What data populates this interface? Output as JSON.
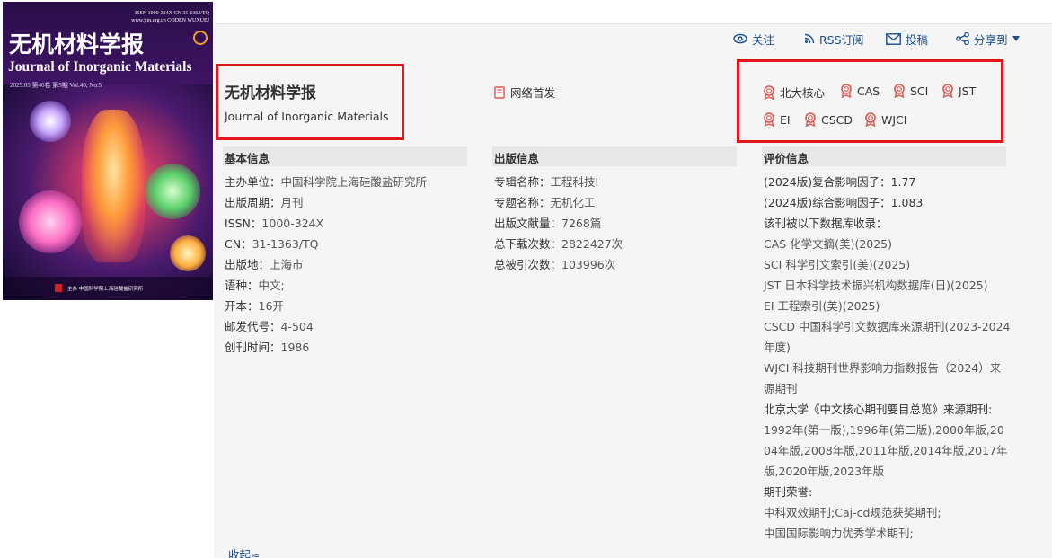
{
  "cover": {
    "issn_line": "ISSN 1000-324X   CN 31-1363/TQ",
    "web_line": "www.jim.org.cn   CODEN WUXUEJ",
    "title_cn": "无机材料学报",
    "title_en": "Journal of Inorganic Materials",
    "issue_line": "2025.05  第40卷  第5期  Vol.40, No.5",
    "footer_line": "主办    中国科学院上海硅酸盐研究所"
  },
  "toolbar": {
    "follow": "关注",
    "rss": "RSS订阅",
    "submit": "投稿",
    "share": "分享到"
  },
  "journal": {
    "title_cn": "无机材料学报",
    "title_en": "Journal of Inorganic Materials",
    "net_first": "网络首发"
  },
  "badges": [
    "北大核心",
    "CAS",
    "SCI",
    "JST",
    "EI",
    "CSCD",
    "WJCI"
  ],
  "basic": {
    "header": "基本信息",
    "rows": [
      {
        "k": "主办单位：",
        "v": "中国科学院上海硅酸盐研究所"
      },
      {
        "k": "出版周期：",
        "v": "月刊"
      },
      {
        "k": "ISSN：",
        "v": "1000-324X"
      },
      {
        "k": "CN：",
        "v": "31-1363/TQ"
      },
      {
        "k": "出版地：",
        "v": "上海市"
      },
      {
        "k": "语种：",
        "v": "中文;"
      },
      {
        "k": "开本：",
        "v": "16开"
      },
      {
        "k": "邮发代号：",
        "v": "4-504"
      },
      {
        "k": "创刊时间：",
        "v": "1986"
      }
    ]
  },
  "publish": {
    "header": "出版信息",
    "rows": [
      {
        "k": "专辑名称：",
        "v": "工程科技I"
      },
      {
        "k": "专题名称：",
        "v": "无机化工"
      },
      {
        "k": "出版文献量：",
        "v": "7268篇"
      },
      {
        "k": "总下载次数：",
        "v": "2822427次"
      },
      {
        "k": "总被引次数：",
        "v": "103996次"
      }
    ]
  },
  "evaluation": {
    "header": "评价信息",
    "composite_if": "(2024版)复合影响因子：1.77",
    "overall_if": "(2024版)综合影响因子：1.083",
    "db_intro": "该刊被以下数据库收录：",
    "databases": [
      "CAS 化学文摘(美)(2025)",
      "SCI 科学引文索引(美)(2025)",
      "JST 日本科学技术振兴机构数据库(日)(2025)",
      "EI 工程索引(美)(2025)",
      "CSCD 中国科学引文数据库来源期刊(2023-2024年度)",
      "WJCI 科技期刊世界影响力指数报告（2024）来源期刊"
    ],
    "pku_intro": "北京大学《中文核心期刊要目总览》来源期刊:",
    "pku_years": "1992年(第一版),1996年(第二版),2000年版,2004年版,2008年版,2011年版,2014年版,2017年版,2020年版,2023年版",
    "honors_label": "期刊荣誉:",
    "honors": [
      "中科双效期刊;Caj-cd规范获奖期刊;",
      "中国国际影响力优秀学术期刊;"
    ]
  },
  "collapse": "收起≈",
  "colors": {
    "link": "#1a4e8f",
    "badge": "#e0574f",
    "highlight_box": "#e0161a"
  }
}
